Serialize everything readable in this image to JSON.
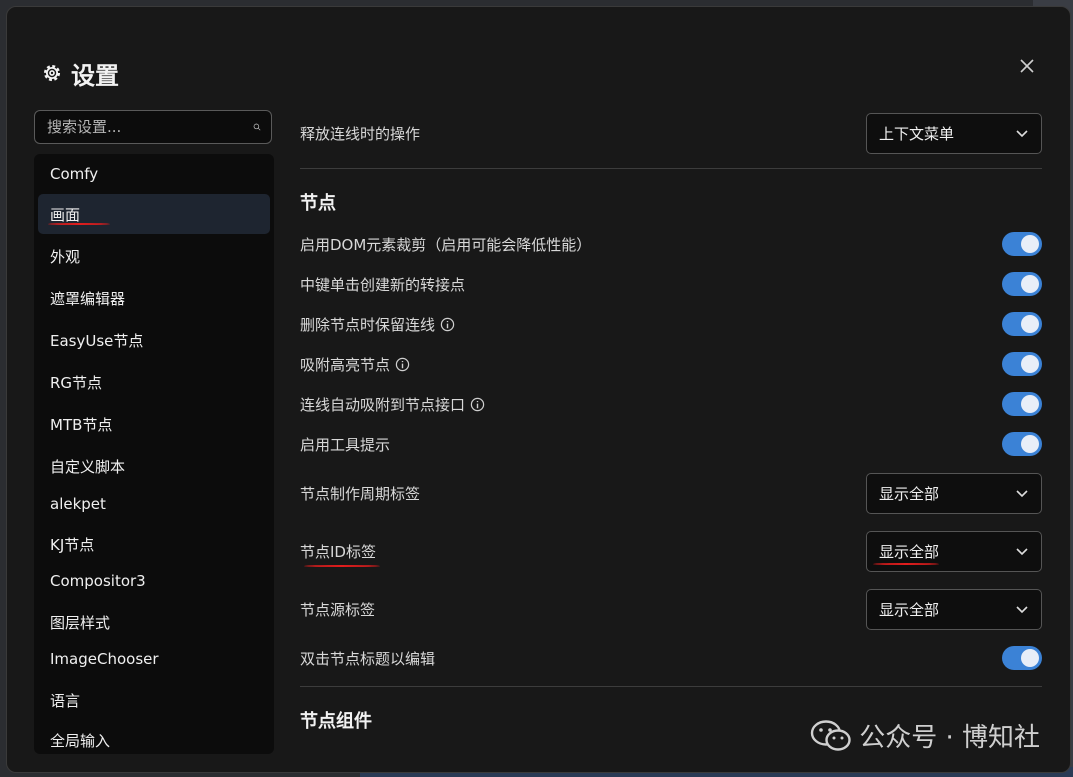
{
  "dialog": {
    "title": "设置",
    "search_placeholder": "搜索设置..."
  },
  "sidebar": {
    "items": [
      {
        "label": "Comfy"
      },
      {
        "label": "画面"
      },
      {
        "label": "外观"
      },
      {
        "label": "遮罩编辑器"
      },
      {
        "label": "EasyUse节点"
      },
      {
        "label": "RG节点"
      },
      {
        "label": "MTB节点"
      },
      {
        "label": "自定义脚本"
      },
      {
        "label": "alekpet"
      },
      {
        "label": "KJ节点"
      },
      {
        "label": "Compositor3"
      },
      {
        "label": "图层样式"
      },
      {
        "label": "ImageChooser"
      },
      {
        "label": "语言"
      },
      {
        "label": "全局输入"
      }
    ],
    "active_index": 1
  },
  "settings": {
    "link_release": {
      "label": "释放连线时的操作",
      "value": "上下文菜单"
    },
    "section_node": "节点",
    "dom_clipping": {
      "label": "启用DOM元素裁剪（启用可能会降低性能）",
      "on": true
    },
    "middle_click_reroute": {
      "label": "中键单击创建新的转接点",
      "on": true
    },
    "keep_links_on_delete": {
      "label": "删除节点时保留连线",
      "on": true
    },
    "snap_highlight": {
      "label": "吸附高亮节点",
      "on": true
    },
    "auto_snap_link": {
      "label": "连线自动吸附到节点接口",
      "on": true
    },
    "tooltips": {
      "label": "启用工具提示",
      "on": true
    },
    "node_lifecycle_badge": {
      "label": "节点制作周期标签",
      "value": "显示全部"
    },
    "node_id_badge": {
      "label": "节点ID标签",
      "value": "显示全部"
    },
    "node_source_badge": {
      "label": "节点源标签",
      "value": "显示全部"
    },
    "dblclick_title_edit": {
      "label": "双击节点标题以编辑",
      "on": true
    },
    "section_widget": "节点组件"
  },
  "watermark": {
    "text": "公众号 · 博知社"
  },
  "colors": {
    "accent": "#3b82d6",
    "annotation": "#e11d1d"
  }
}
